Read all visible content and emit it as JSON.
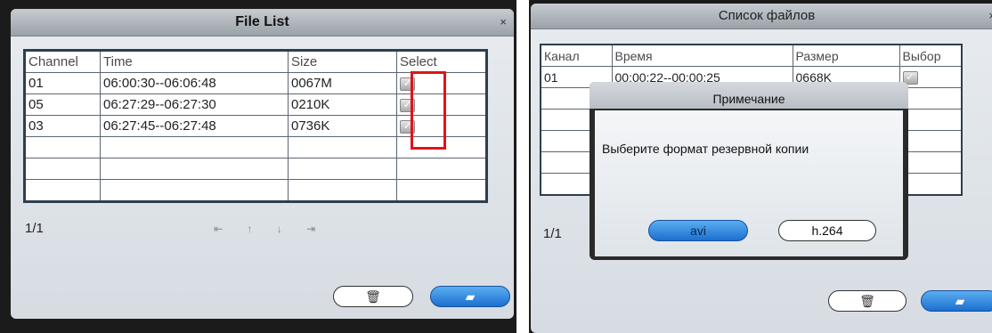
{
  "left": {
    "title": "File List",
    "close": "×",
    "columns": [
      "Channel",
      "Time",
      "Size",
      "Select"
    ],
    "rows": [
      {
        "channel": "01",
        "time": "06:00:30--06:06:48",
        "size": "0067M",
        "checked": true
      },
      {
        "channel": "05",
        "time": "06:27:29--06:27:30",
        "size": "0210K",
        "checked": true
      },
      {
        "channel": "03",
        "time": "06:27:45--06:27:48",
        "size": "0736K",
        "checked": true
      }
    ],
    "page": "1/1",
    "nav": [
      "⇤",
      "↑",
      "↓",
      "⇥"
    ],
    "highlight_color": "#e0141a"
  },
  "right": {
    "title": "Список файлов",
    "close": "×",
    "columns": [
      "Канал",
      "Время",
      "Размер",
      "Выбор"
    ],
    "rows": [
      {
        "channel": "01",
        "time": "00:00:22--00:00:25",
        "size": "0668K",
        "checked": true
      }
    ],
    "page": "1/1",
    "dialog": {
      "title": "Примечание",
      "message": "Выберите формат резервной копии",
      "avi_label": "avi",
      "h264_label": "h.264"
    }
  },
  "colors": {
    "accent_blue": "#1c6fd0"
  }
}
